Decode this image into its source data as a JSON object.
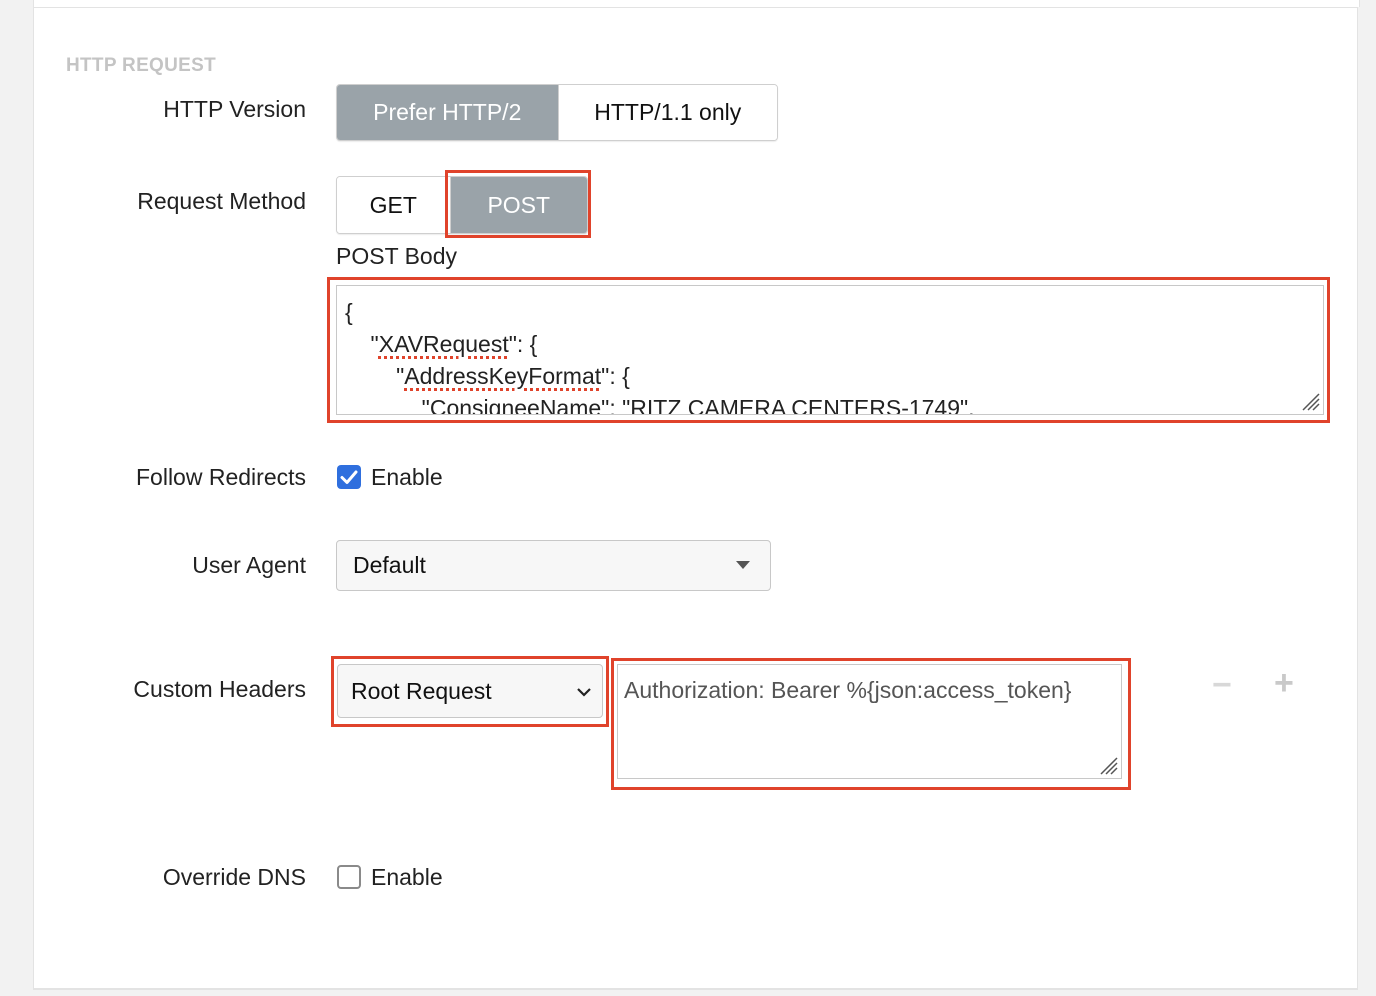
{
  "section": {
    "title": "HTTP REQUEST"
  },
  "http_version": {
    "label": "HTTP Version",
    "options": [
      "Prefer HTTP/2",
      "HTTP/1.1 only"
    ],
    "selected": "Prefer HTTP/2"
  },
  "request_method": {
    "label": "Request Method",
    "options": [
      "GET",
      "POST"
    ],
    "selected": "POST"
  },
  "post_body": {
    "label": "POST Body",
    "lines": [
      "{",
      "    \"XAVRequest\": {",
      "        \"AddressKeyFormat\": {",
      "            \"ConsigneeName\": \"RITZ CAMERA CENTERS-1749\","
    ]
  },
  "follow_redirects": {
    "label": "Follow Redirects",
    "checkbox_label": "Enable",
    "checked": true
  },
  "user_agent": {
    "label": "User Agent",
    "value": "Default"
  },
  "custom_headers": {
    "label": "Custom Headers",
    "scope_value": "Root Request",
    "header_value": "Authorization: Bearer %{json:access_token}",
    "remove_symbol": "−",
    "add_symbol": "+"
  },
  "override_dns": {
    "label": "Override DNS",
    "checkbox_label": "Enable",
    "checked": false
  },
  "colors": {
    "highlight": "#e0432b",
    "segment_active": "#9aa3a9",
    "checkbox_checked": "#2f6fde"
  }
}
